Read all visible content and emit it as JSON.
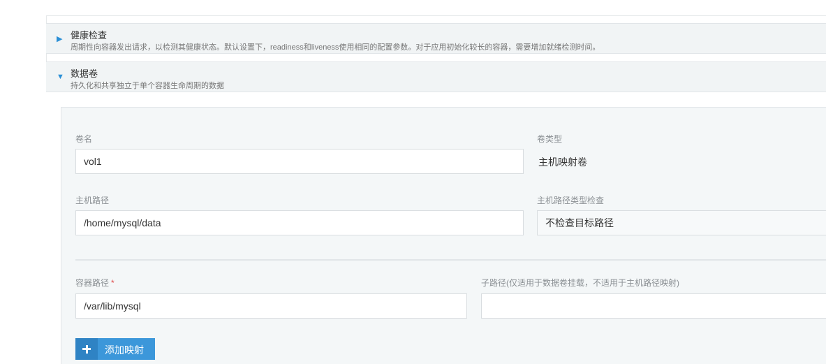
{
  "health_check": {
    "title": "健康检查",
    "description": "周期性向容器发出请求，以检测其健康状态。默认设置下，readiness和liveness使用相同的配置参数。对于应用初始化较长的容器，需要增加就绪检测时间。",
    "caret": "▶",
    "expanded": false
  },
  "volumes": {
    "title": "数据卷",
    "description": "持久化和共享独立于单个容器生命周期的数据",
    "caret": "▼",
    "expanded": true,
    "volume": {
      "name_label": "卷名",
      "name_value": "vol1",
      "type_label": "卷类型",
      "type_value": "主机映射卷",
      "host_path_label": "主机路径",
      "host_path_value": "/home/mysql/data",
      "host_path_check_label": "主机路径类型检查",
      "host_path_check_value": "不检查目标路径",
      "container_path_label": "容器路径",
      "required_mark": "*",
      "container_path_value": "/var/lib/mysql",
      "sub_path_label": "子路径(仅适用于数据卷挂载，不适用于主机路径映射)",
      "sub_path_value": ""
    },
    "add_mapping_label": "添加映射",
    "add_icon": "plus-icon"
  }
}
